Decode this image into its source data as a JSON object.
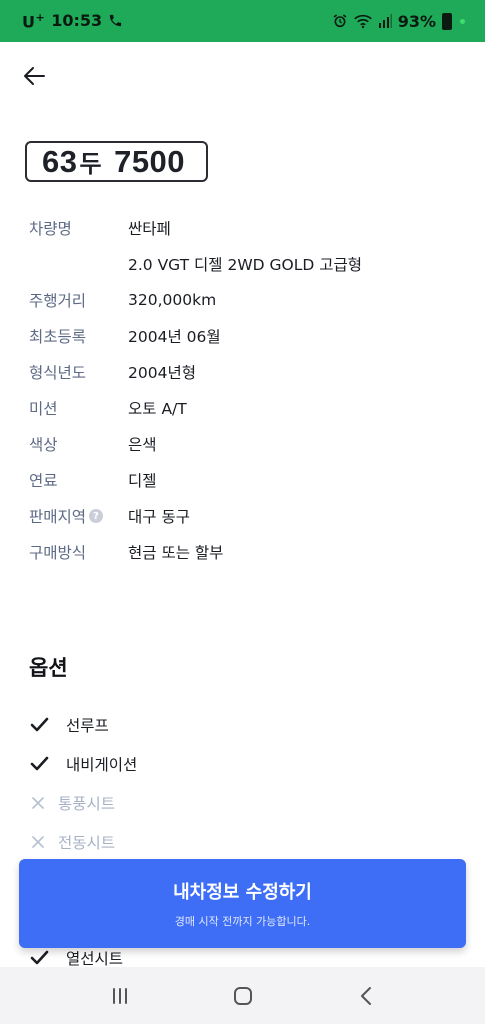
{
  "status_bar": {
    "carrier": "U",
    "carrier_plus": "+",
    "time": "10:53",
    "battery": "93%"
  },
  "vehicle": {
    "plate_prefix": "63",
    "plate_middle": "두",
    "plate_number": "7500"
  },
  "specs": [
    {
      "label": "차량명",
      "value": "싼타페"
    },
    {
      "label": "",
      "value": "2.0 VGT 디젤 2WD GOLD 고급형"
    },
    {
      "label": "주행거리",
      "value": "320,000km"
    },
    {
      "label": "최초등록",
      "value": "2004년 06월"
    },
    {
      "label": "형식년도",
      "value": "2004년형"
    },
    {
      "label": "미션",
      "value": "오토 A/T"
    },
    {
      "label": "색상",
      "value": "은색"
    },
    {
      "label": "연료",
      "value": "디젤"
    },
    {
      "label": "판매지역",
      "value": "대구 동구"
    },
    {
      "label": "구매방식",
      "value": "현금 또는 할부"
    }
  ],
  "options": {
    "title": "옵션",
    "items": [
      {
        "label": "선루프",
        "checked": true
      },
      {
        "label": "내비게이션",
        "checked": true
      },
      {
        "label": "통풍시트",
        "checked": false
      },
      {
        "label": "전동시트",
        "checked": false
      },
      {
        "label": "열선시트",
        "checked": true
      }
    ]
  },
  "cta": {
    "title": "내차정보 수정하기",
    "subtitle": "경매 시작 전까지 가능합니다."
  },
  "colors": {
    "status_bar": "#1faa59",
    "primary": "#3d6ef5",
    "label": "#5d6a86",
    "disabled": "#a8b2c7"
  }
}
